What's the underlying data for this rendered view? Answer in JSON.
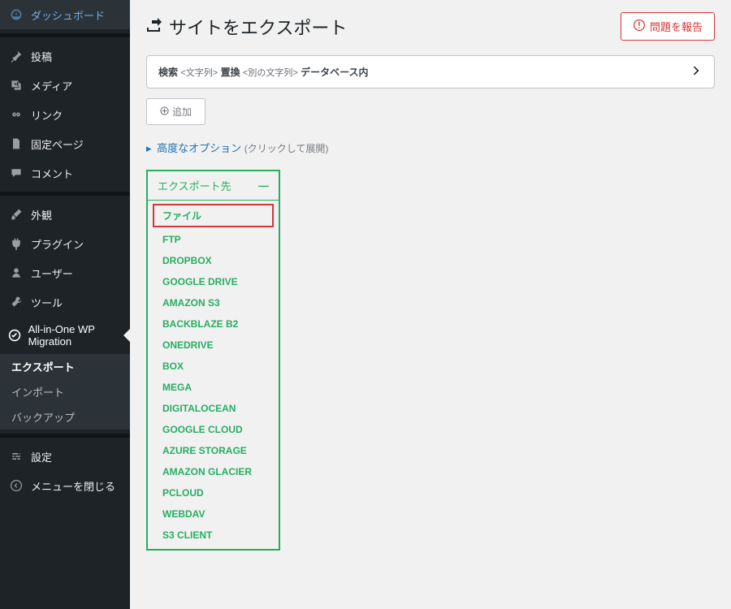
{
  "sidebar": {
    "items": [
      {
        "icon": "dashboard",
        "label": "ダッシュボード"
      },
      {
        "sep": true
      },
      {
        "icon": "pin",
        "label": "投稿"
      },
      {
        "icon": "media",
        "label": "メディア"
      },
      {
        "icon": "link",
        "label": "リンク"
      },
      {
        "icon": "page",
        "label": "固定ページ"
      },
      {
        "icon": "comment",
        "label": "コメント"
      },
      {
        "sep": true
      },
      {
        "icon": "brush",
        "label": "外観"
      },
      {
        "icon": "plugin",
        "label": "プラグイン"
      },
      {
        "icon": "user",
        "label": "ユーザー"
      },
      {
        "icon": "tools",
        "label": "ツール"
      },
      {
        "icon": "migration",
        "label": "All-in-One WP Migration",
        "current": true
      },
      {
        "sep": true,
        "submenu": true
      },
      {
        "icon": "settings",
        "label": "設定"
      },
      {
        "icon": "collapse",
        "label": "メニューを閉じる"
      }
    ],
    "submenu": [
      {
        "label": "エクスポート",
        "active": true
      },
      {
        "label": "インポート"
      },
      {
        "label": "バックアップ"
      }
    ]
  },
  "header": {
    "title": "サイトをエクスポート",
    "report_issue": "問題を報告"
  },
  "find_replace": {
    "search_label": "検索",
    "search_ph": "<文字列>",
    "replace_label": "置換",
    "replace_ph": "<別の文字列>",
    "in_db": "データベース内"
  },
  "add_button": "追加",
  "advanced": {
    "link": "高度なオプション",
    "hint": "(クリックして展開)"
  },
  "export": {
    "header": "エクスポート先",
    "destinations": [
      "ファイル",
      "FTP",
      "DROPBOX",
      "GOOGLE DRIVE",
      "AMAZON S3",
      "BACKBLAZE B2",
      "ONEDRIVE",
      "BOX",
      "MEGA",
      "DIGITALOCEAN",
      "GOOGLE CLOUD",
      "AZURE STORAGE",
      "AMAZON GLACIER",
      "PCLOUD",
      "WEBDAV",
      "S3 CLIENT"
    ]
  }
}
